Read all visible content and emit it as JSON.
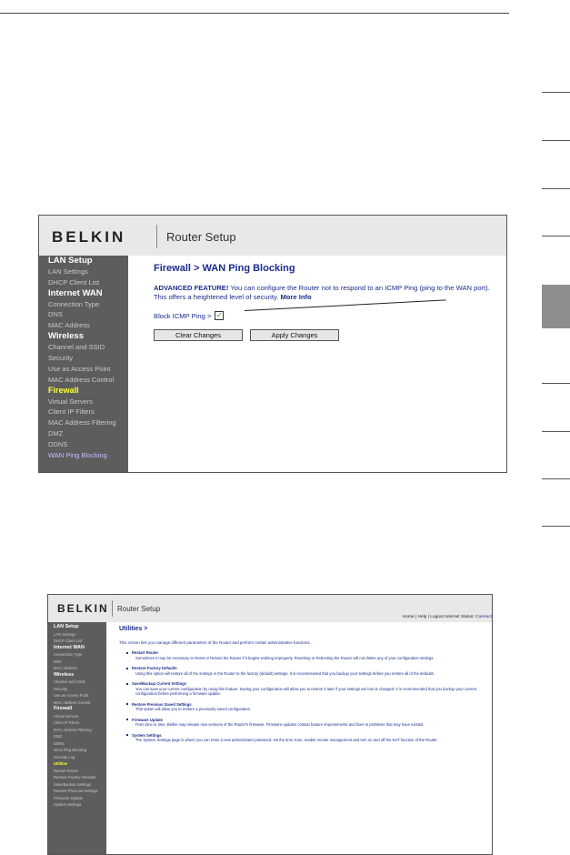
{
  "screenshot1": {
    "logo": "BELKIN",
    "header_title": "Router Setup",
    "nav": [
      {
        "label": "LAN Setup",
        "type": "head"
      },
      {
        "label": "LAN Settings",
        "type": "item"
      },
      {
        "label": "DHCP Client List",
        "type": "item"
      },
      {
        "label": "Internet WAN",
        "type": "head"
      },
      {
        "label": "Connection Type",
        "type": "item"
      },
      {
        "label": "DNS",
        "type": "item"
      },
      {
        "label": "MAC Address",
        "type": "item"
      },
      {
        "label": "Wireless",
        "type": "head"
      },
      {
        "label": "Channel and SSID",
        "type": "item"
      },
      {
        "label": "Security",
        "type": "item"
      },
      {
        "label": "Use as Access Point",
        "type": "item"
      },
      {
        "label": "MAC Address Control",
        "type": "item"
      },
      {
        "label": "Firewall",
        "type": "hl"
      },
      {
        "label": "Virtual Servers",
        "type": "item"
      },
      {
        "label": "Client IP Filters",
        "type": "item"
      },
      {
        "label": "MAC Address Filtering",
        "type": "item"
      },
      {
        "label": "DMZ",
        "type": "item"
      },
      {
        "label": "DDNS",
        "type": "item"
      },
      {
        "label": "WAN Ping Blocking",
        "type": "active"
      }
    ],
    "page_heading": "Firewall > WAN Ping Blocking",
    "advanced_label": "ADVANCED FEATURE!",
    "description": " You can configure the Router not to respond to an ICMP Ping (ping to the WAN port). This offers a heightened level of security.",
    "more_info": "More Info",
    "block_ping_label": "Block ICMP Ping >",
    "block_ping_checked": true,
    "clear_button": "Clear Changes",
    "apply_button": "Apply Changes"
  },
  "screenshot2": {
    "logo": "BELKIN",
    "header_title": "Router Setup",
    "top_links": "Home | Help | Logout",
    "internet_status_label": "Internet Status:",
    "internet_status_value": "Connect",
    "nav": [
      {
        "label": "LAN Setup",
        "type": "head"
      },
      {
        "label": "LAN Settings",
        "type": "item"
      },
      {
        "label": "DHCP Client List",
        "type": "item"
      },
      {
        "label": "Internet WAN",
        "type": "head"
      },
      {
        "label": "Connection Type",
        "type": "item"
      },
      {
        "label": "DNS",
        "type": "item"
      },
      {
        "label": "MAC Address",
        "type": "item"
      },
      {
        "label": "Wireless",
        "type": "head"
      },
      {
        "label": "Channel and SSID",
        "type": "item"
      },
      {
        "label": "Security",
        "type": "item"
      },
      {
        "label": "Use as Access Point",
        "type": "item"
      },
      {
        "label": "MAC Address Control",
        "type": "item"
      },
      {
        "label": "Firewall",
        "type": "head"
      },
      {
        "label": "Virtual Servers",
        "type": "item"
      },
      {
        "label": "Client IP Filters",
        "type": "item"
      },
      {
        "label": "MAC Address Filtering",
        "type": "item"
      },
      {
        "label": "DMZ",
        "type": "item"
      },
      {
        "label": "DDNS",
        "type": "item"
      },
      {
        "label": "WAN Ping Blocking",
        "type": "item"
      },
      {
        "label": "Security Log",
        "type": "item"
      },
      {
        "label": "Utilities",
        "type": "hl"
      },
      {
        "label": "Restart Router",
        "type": "item"
      },
      {
        "label": "Restore Factory Defaults",
        "type": "item"
      },
      {
        "label": "Save/Backup Settings",
        "type": "item"
      },
      {
        "label": "Restore Previous Settings",
        "type": "item"
      },
      {
        "label": "Firmware Update",
        "type": "item"
      },
      {
        "label": "System Settings",
        "type": "item"
      }
    ],
    "page_heading": "Utilities >",
    "intro": "This screen lets you manage different parameters of the Router and perform certain administrative functions.",
    "utilities": [
      {
        "title": "Restart Router",
        "desc": "Sometimes it may be necessary to Reset or Reboot the Router if it begins working improperly. Resetting or Rebooting the Router will not delete any of your configuration settings."
      },
      {
        "title": "Restore Factory Defaults",
        "desc": "Using this option will restore all of the settings in the Router to the factory (default) settings. It is recommended that you backup your settings before you restore all of the defaults."
      },
      {
        "title": "Save/Backup Current Settings",
        "desc": "You can save your current configuration by using this feature. Saving your configuration will allow you to restore it later if your settings are lost or changed. It is recommended that you backup your current configuration before performing a firmware update."
      },
      {
        "title": "Restore Previous Saved Settings",
        "desc": "This option will allow you to restore a previously saved configuration."
      },
      {
        "title": "Firmware Update",
        "desc": "From time to time, Belkin may release new versions of the Router's firmware. Firmware updates contain feature improvements and fixes to problems that may have existed."
      },
      {
        "title": "System Settings",
        "desc": "The System Settings page is where you can enter a new administrator password, set the time zone, enable remote management and turn on and off the NAT function of the Router."
      }
    ]
  },
  "colors": {
    "nav_bg": "#5d5d5d",
    "highlight": "#ffff33",
    "heading_blue": "#1c2c8f",
    "header_bg": "#e8e8e8"
  }
}
